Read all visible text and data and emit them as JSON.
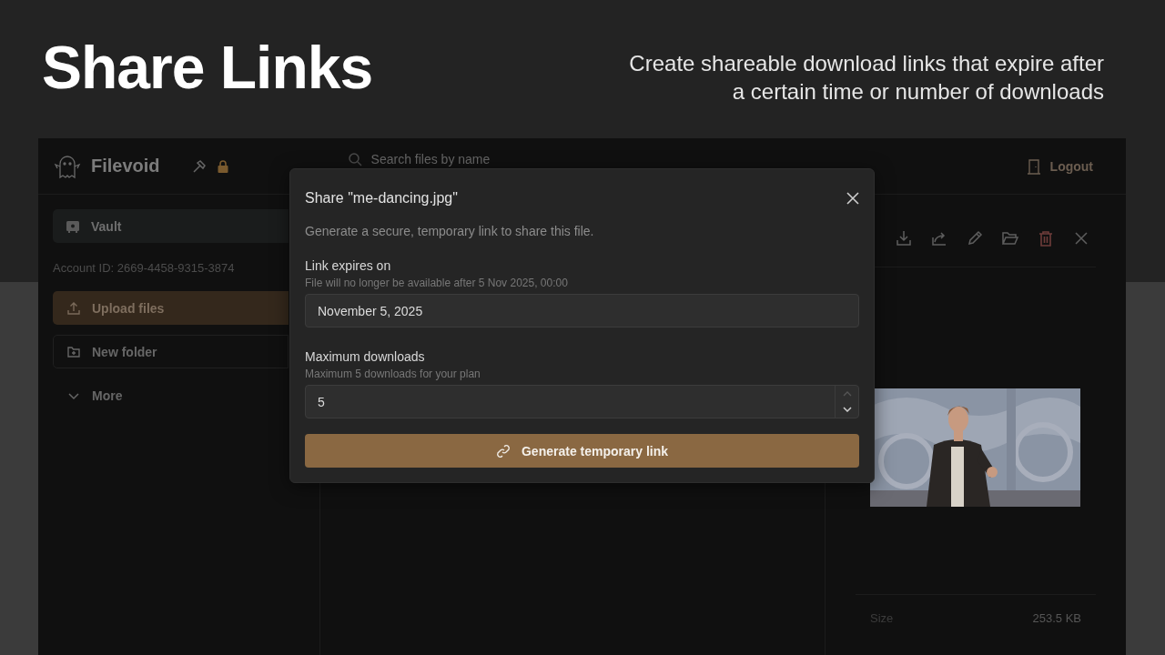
{
  "banner": {
    "title": "Share Links",
    "subtitle": "Create shareable download links that expire after a certain time or number of downloads"
  },
  "app": {
    "brand": "Filevoid",
    "search": {
      "placeholder": "Search files by name"
    },
    "logout": "Logout",
    "sidebar": {
      "vault": "Vault",
      "account_id": "Account ID: 2669-4458-9315-3874",
      "actions": [
        {
          "kind": "primary",
          "label": "Upload files"
        },
        {
          "kind": "outline",
          "label": "New folder"
        },
        {
          "kind": "plain",
          "label": "More"
        }
      ]
    },
    "details": {
      "size_label": "Size",
      "size_value": "253.5 KB"
    }
  },
  "dialog": {
    "title": "Share \"me-dancing.jpg\"",
    "description": "Generate a secure, temporary link to share this file.",
    "fields": [
      {
        "kind": "date",
        "label": "Link expires on",
        "hint": "File will no longer be available after 5 Nov 2025, 00:00",
        "value": "November 5, 2025"
      },
      {
        "kind": "number",
        "label": "Maximum downloads",
        "hint": "Maximum 5 downloads for your plan",
        "value": "5"
      }
    ],
    "submit": "Generate temporary link"
  }
}
